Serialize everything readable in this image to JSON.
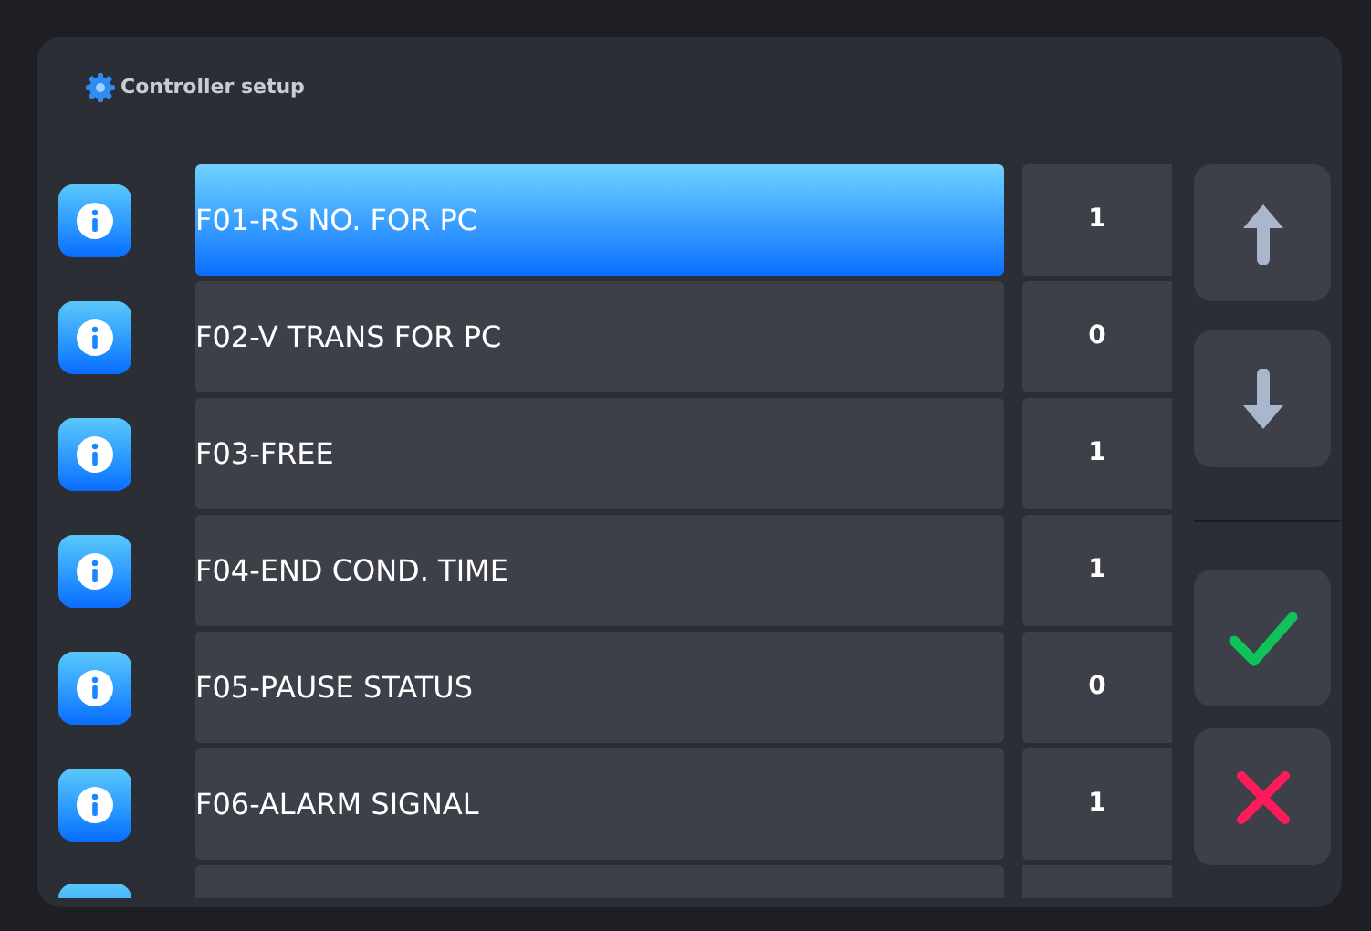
{
  "header": {
    "title": "Controller setup"
  },
  "parameters": [
    {
      "label": "F01-RS NO. FOR PC",
      "value": "1",
      "selected": true
    },
    {
      "label": "F02-V TRANS FOR PC",
      "value": "0",
      "selected": false
    },
    {
      "label": "F03-FREE",
      "value": "1",
      "selected": false
    },
    {
      "label": "F04-END COND. TIME",
      "value": "1",
      "selected": false
    },
    {
      "label": "F05-PAUSE STATUS",
      "value": "0",
      "selected": false
    },
    {
      "label": "F06-ALARM SIGNAL",
      "value": "1",
      "selected": false
    }
  ]
}
